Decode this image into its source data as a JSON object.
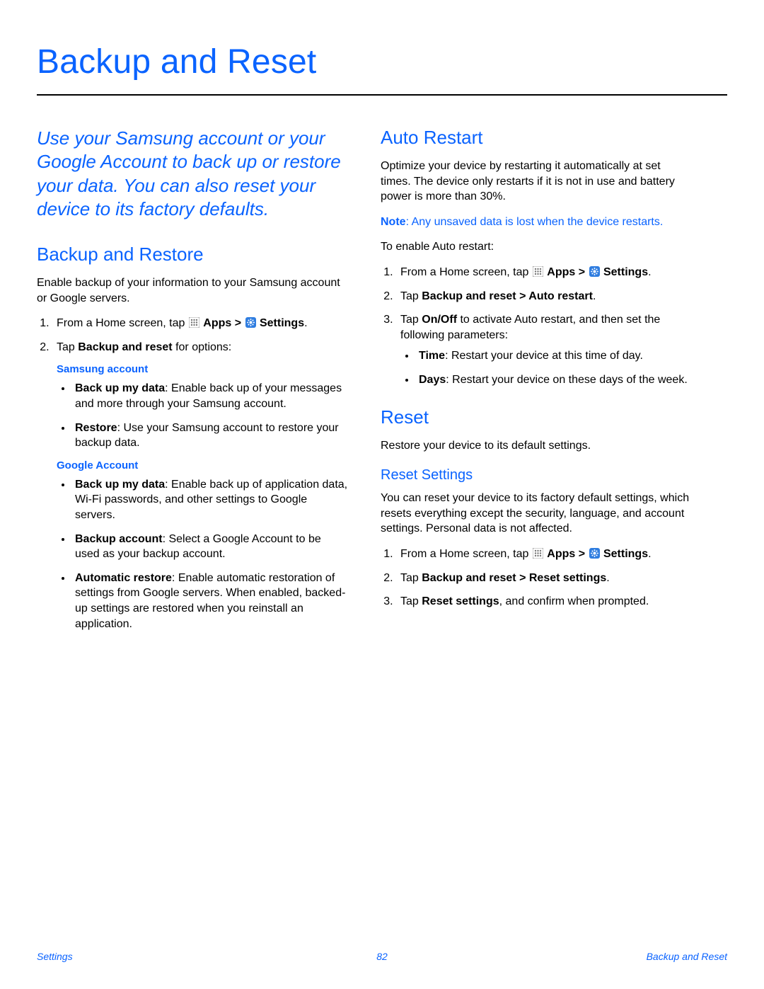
{
  "page": {
    "title": "Backup and Reset",
    "footer_left": "Settings",
    "footer_center": "82",
    "footer_right": "Backup and Reset"
  },
  "lede": "Use your Samsung account or your Google Account to back up or restore your data. You can also reset your device to its factory defaults.",
  "backup_restore": {
    "heading": "Backup and Restore",
    "intro": "Enable backup of your information to your Samsung account or Google servers.",
    "step1_a": "From a Home screen, tap ",
    "apps_label": " Apps",
    "gt": " > ",
    "settings_label": " Settings",
    "period": ".",
    "step2_a": "Tap ",
    "step2_b": "Backup and reset",
    "step2_c": " for options:",
    "samsung_label": "Samsung account",
    "samsung_items": {
      "a_b": "Back up my data",
      "a_t": ": Enable back up of your messages and more through your Samsung account.",
      "b_b": "Restore",
      "b_t": ": Use your Samsung account to restore your backup data."
    },
    "google_label": "Google Account",
    "google_items": {
      "a_b": "Back up my data",
      "a_t": ": Enable back up of application data, Wi-Fi passwords, and other settings to Google servers.",
      "b_b": "Backup account",
      "b_t": ": Select a Google Account to be used as your backup account.",
      "c_b": "Automatic restore",
      "c_t": ": Enable automatic restoration of settings from Google servers. When enabled, backed-up settings are restored when you reinstall an application."
    }
  },
  "auto_restart": {
    "heading": "Auto Restart",
    "intro": "Optimize your device by restarting it automatically at set times. The device only restarts if it is not in use and battery power is more than 30%.",
    "note_b": "Note",
    "note_t": ": Any unsaved data is lost when the device restarts.",
    "enable": "To enable Auto restart:",
    "step1_a": "From a Home screen, tap ",
    "step2": "Tap ",
    "step2_b": "Backup and reset > Auto restart",
    "step3_a": "Tap ",
    "step3_b": "On/Off",
    "step3_c": " to activate Auto restart, and then set the following parameters:",
    "time_b": "Time",
    "time_t": ": Restart your device at this time of day.",
    "days_b": "Days",
    "days_t": ": Restart your device on these days of the week."
  },
  "reset": {
    "heading": "Reset",
    "intro": "Restore your device to its default settings.",
    "sub_heading": "Reset Settings",
    "sub_intro": "You can reset your device to its factory default settings, which resets everything except the security, language, and account settings. Personal data is not affected.",
    "step2": "Tap ",
    "step2_b": "Backup and reset > Reset settings",
    "step3_a": "Tap ",
    "step3_b": "Reset settings",
    "step3_c": ", and confirm when prompted."
  }
}
